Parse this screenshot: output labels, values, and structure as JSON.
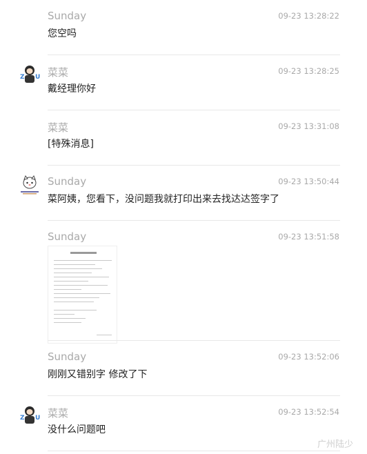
{
  "messages": [
    {
      "sender": "Sunday",
      "time": "09-23 13:28:22",
      "text": "您空吗"
    },
    {
      "sender": "菜菜",
      "time": "09-23 13:28:25",
      "text": "戴经理你好"
    },
    {
      "sender": "菜菜",
      "time": "09-23 13:31:08",
      "text": "[特殊消息]"
    },
    {
      "sender": "Sunday",
      "time": "09-23 13:50:44",
      "text": "菜阿姨，您看下，没问题我就打印出来去找达达签字了"
    },
    {
      "sender": "Sunday",
      "time": "09-23 13:51:58",
      "text": ""
    },
    {
      "sender": "Sunday",
      "time": "09-23 13:52:06",
      "text": "刚刚又错别字 修改了下"
    },
    {
      "sender": "菜菜",
      "time": "09-23 13:52:54",
      "text": "没什么问题吧"
    }
  ],
  "watermark": "广州陆少",
  "colors": {
    "meta": "#a9a9a9",
    "text": "#222222",
    "separator": "#e8e8e8"
  }
}
